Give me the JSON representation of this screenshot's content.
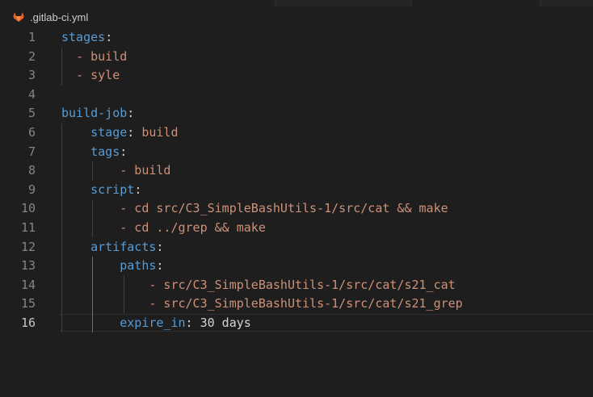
{
  "tab": {
    "filename": ".gitlab-ci.yml",
    "icon": "gitlab-icon"
  },
  "colors": {
    "background": "#1e1e1e",
    "key": "#569cd6",
    "value": "#ce9178",
    "punctuation": "#d4d4d4",
    "line_number": "#858585",
    "gitlab_orange": "#e24329"
  },
  "editor": {
    "active_line": 16,
    "lines": [
      {
        "n": "1",
        "tokens": [
          {
            "t": "stages",
            "c": "k"
          },
          {
            "t": ":",
            "c": "p"
          }
        ]
      },
      {
        "n": "2",
        "tokens": [
          {
            "t": "  ",
            "c": "p"
          },
          {
            "t": "- build",
            "c": "v"
          }
        ]
      },
      {
        "n": "3",
        "tokens": [
          {
            "t": "  ",
            "c": "p"
          },
          {
            "t": "- syle",
            "c": "v"
          }
        ]
      },
      {
        "n": "4",
        "tokens": []
      },
      {
        "n": "5",
        "tokens": [
          {
            "t": "build-job",
            "c": "k"
          },
          {
            "t": ":",
            "c": "p"
          }
        ]
      },
      {
        "n": "6",
        "tokens": [
          {
            "t": "    ",
            "c": "p"
          },
          {
            "t": "stage",
            "c": "k"
          },
          {
            "t": ": ",
            "c": "p"
          },
          {
            "t": "build",
            "c": "v"
          }
        ]
      },
      {
        "n": "7",
        "tokens": [
          {
            "t": "    ",
            "c": "p"
          },
          {
            "t": "tags",
            "c": "k"
          },
          {
            "t": ":",
            "c": "p"
          }
        ]
      },
      {
        "n": "8",
        "tokens": [
          {
            "t": "        ",
            "c": "p"
          },
          {
            "t": "- build",
            "c": "v"
          }
        ]
      },
      {
        "n": "9",
        "tokens": [
          {
            "t": "    ",
            "c": "p"
          },
          {
            "t": "script",
            "c": "k"
          },
          {
            "t": ":",
            "c": "p"
          }
        ]
      },
      {
        "n": "10",
        "tokens": [
          {
            "t": "        ",
            "c": "p"
          },
          {
            "t": "- cd src/C3_SimpleBashUtils-1/src/cat && make",
            "c": "v"
          }
        ]
      },
      {
        "n": "11",
        "tokens": [
          {
            "t": "        ",
            "c": "p"
          },
          {
            "t": "- cd ../grep && make",
            "c": "v"
          }
        ]
      },
      {
        "n": "12",
        "tokens": [
          {
            "t": "    ",
            "c": "p"
          },
          {
            "t": "artifacts",
            "c": "k"
          },
          {
            "t": ":",
            "c": "p"
          }
        ]
      },
      {
        "n": "13",
        "tokens": [
          {
            "t": "        ",
            "c": "p"
          },
          {
            "t": "paths",
            "c": "k"
          },
          {
            "t": ":",
            "c": "p"
          }
        ]
      },
      {
        "n": "14",
        "tokens": [
          {
            "t": "            ",
            "c": "p"
          },
          {
            "t": "- src/C3_SimpleBashUtils-1/src/cat/s21_cat",
            "c": "v"
          }
        ]
      },
      {
        "n": "15",
        "tokens": [
          {
            "t": "            ",
            "c": "p"
          },
          {
            "t": "- src/C3_SimpleBashUtils-1/src/cat/s21_grep",
            "c": "v"
          }
        ]
      },
      {
        "n": "16",
        "tokens": [
          {
            "t": "        ",
            "c": "p"
          },
          {
            "t": "expire_in",
            "c": "k"
          },
          {
            "t": ": ",
            "c": "p"
          },
          {
            "t": "30 days",
            "c": "p"
          }
        ]
      }
    ]
  }
}
